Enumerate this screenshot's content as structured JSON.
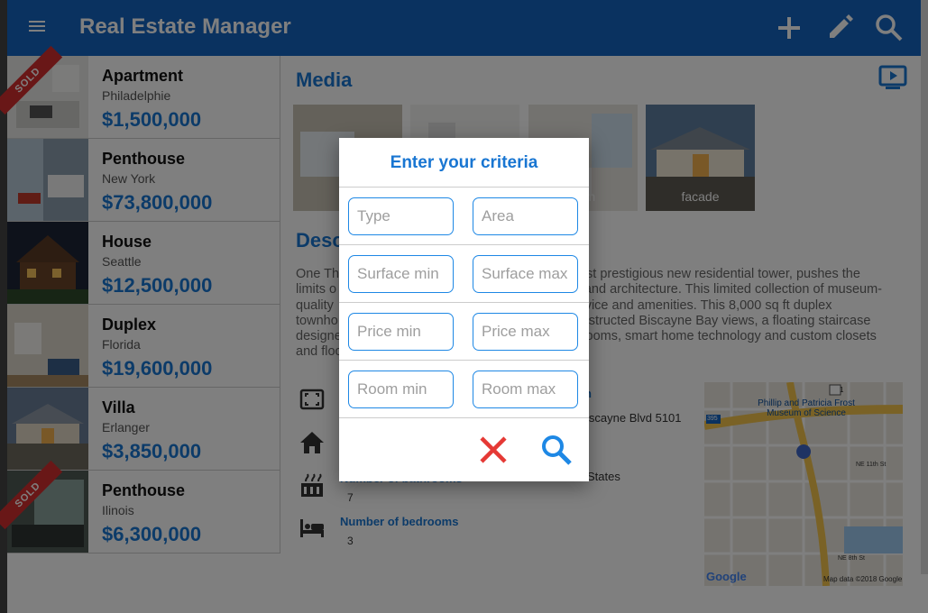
{
  "app": {
    "title": "Real Estate Manager"
  },
  "listings": [
    {
      "type": "Apartment",
      "city": "Philadelphie",
      "price": "$1,500,000",
      "sold": true
    },
    {
      "type": "Penthouse",
      "city": "New York",
      "price": "$73,800,000",
      "sold": false
    },
    {
      "type": "House",
      "city": "Seattle",
      "price": "$12,500,000",
      "sold": false
    },
    {
      "type": "Duplex",
      "city": "Florida",
      "price": "$19,600,000",
      "sold": false
    },
    {
      "type": "Villa",
      "city": "Erlanger",
      "price": "$3,850,000",
      "sold": false
    },
    {
      "type": "Penthouse",
      "city": "Ilinois",
      "price": "$6,300,000",
      "sold": true
    }
  ],
  "sold_label": "SOLD",
  "detail": {
    "media_heading": "Media",
    "media": [
      {
        "caption": "Lo"
      },
      {
        "caption": ""
      },
      {
        "caption": "oom"
      },
      {
        "caption": "facade"
      }
    ],
    "description_heading": "Desc",
    "description_lines": [
      "One Th                                                               most prestigious new residential tower, pushes the",
      "limits o                                                                 rt and architecture. This limited collection of museum-",
      "quality                                                                  ervice and amenities. This 8,000 sq ft duplex",
      "townho                                                                   bstructed Biscayne Bay views, a floating staircase",
      "designe                                                                  rooms, smart home technology and custom closets",
      "and floo"
    ],
    "location_label_fragment": "n",
    "address_fragment": "iscayne Blvd 5101",
    "country_fragment": "States",
    "bathrooms_label": "Number of bathrooms",
    "bathrooms_value": "7",
    "bedrooms_label": "Number of bedrooms",
    "bedrooms_value": "3",
    "map": {
      "museum_label": "Phillip and Patricia Frost Museum of Science",
      "street1": "NE 11th St",
      "street2": "NE 8th St",
      "shield1": "1",
      "shield2": "395",
      "google": "Google",
      "attribution": "Map data ©2018 Google"
    }
  },
  "dialog": {
    "title": "Enter your criteria",
    "fields": [
      {
        "left": "Type",
        "right": "Area"
      },
      {
        "left": "Surface min",
        "right": "Surface max"
      },
      {
        "left": "Price min",
        "right": "Price max"
      },
      {
        "left": "Room min",
        "right": "Room max"
      }
    ]
  },
  "colors": {
    "primary": "#1565c0",
    "accent": "#1976d2",
    "cancel": "#e53935",
    "search": "#1e88e5"
  }
}
